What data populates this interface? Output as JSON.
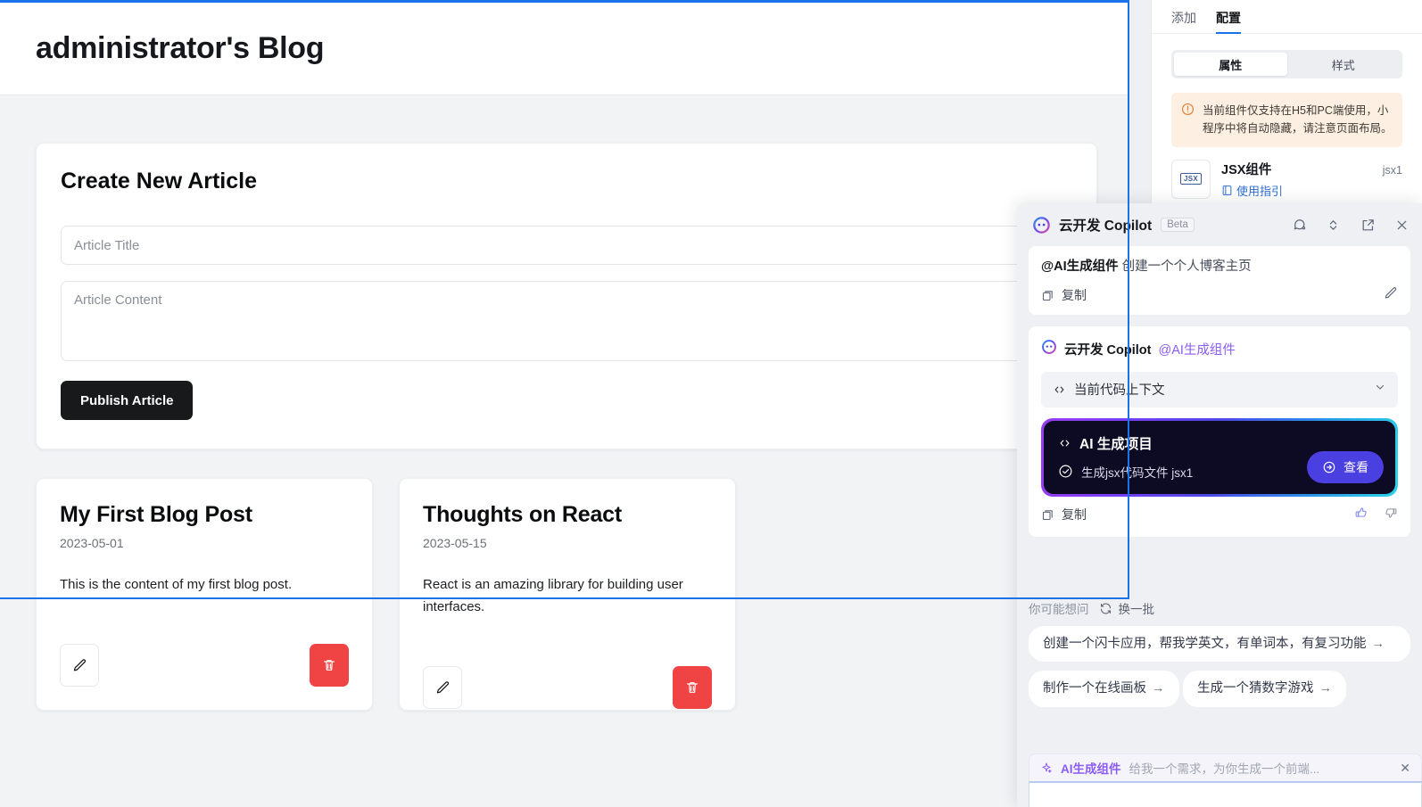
{
  "canvas": {
    "header_title": "administrator's Blog",
    "create": {
      "heading": "Create New Article",
      "title_placeholder": "Article Title",
      "title_value": "",
      "content_placeholder": "Article Content",
      "content_value": "",
      "publish_label": "Publish Article"
    },
    "posts": [
      {
        "title": "My First Blog Post",
        "date": "2023-05-01",
        "body": "This is the content of my first blog post.",
        "edit_icon": "pencil-icon",
        "delete_icon": "trash-icon"
      },
      {
        "title": "Thoughts on React",
        "date": "2023-05-15",
        "body": "React is an amazing library for building user interfaces.",
        "edit_icon": "pencil-icon",
        "delete_icon": "trash-icon"
      }
    ]
  },
  "rightbar": {
    "tabs": [
      {
        "label": "添加",
        "active": false
      },
      {
        "label": "配置",
        "active": true
      }
    ],
    "segments": [
      {
        "label": "属性",
        "active": true
      },
      {
        "label": "样式",
        "active": false
      }
    ],
    "warning": {
      "icon": "warning-circle-icon",
      "text": "当前组件仅支持在H5和PC端使用，小程序中将自动隐藏，请注意页面布局。"
    },
    "component": {
      "badge": "JSX",
      "name": "JSX组件",
      "id": "jsx1",
      "link_label": "使用指引",
      "link_icon": "book-icon"
    }
  },
  "copilot": {
    "logo_icon": "copilot-logo-icon",
    "title": "云开发 Copilot",
    "beta": "Beta",
    "actions": [
      {
        "icon": "chat-history-icon"
      },
      {
        "icon": "expand-collapse-icon"
      },
      {
        "icon": "open-external-icon"
      },
      {
        "icon": "close-icon"
      }
    ],
    "user_message": {
      "mention": "@AI生成组件",
      "text": "创建一个个人博客主页",
      "copy_label": "复制",
      "copy_icon": "copy-icon",
      "edit_icon": "pencil-icon"
    },
    "ai_message": {
      "name": "云开发 Copilot",
      "mention": "@AI生成组件",
      "context_bar": {
        "icon": "code-tag-icon",
        "label": "当前代码上下文",
        "chevron": "chevron-down-icon"
      },
      "project_card": {
        "icon": "code-tag-icon",
        "title": "AI 生成项目",
        "status_icon": "check-circle-icon",
        "status_text": "生成jsx代码文件 jsx1",
        "view_label": "查看",
        "view_icon": "arrow-right-circle-icon",
        "gradient": [
          "#9a3df0",
          "#4f46e5",
          "#2ed3e8"
        ],
        "background": "#0d0b24"
      },
      "copy_label": "复制",
      "copy_icon": "copy-icon",
      "like_icon": "thumbs-up-icon",
      "dislike_icon": "thumbs-down-icon"
    },
    "suggestions": {
      "label": "你可能想问",
      "refresh_label": "换一批",
      "refresh_icon": "refresh-icon",
      "items": [
        "创建一个闪卡应用，帮我学英文，有单词本，有复习功能",
        "制作一个在线画板",
        "生成一个猜数字游戏"
      ],
      "arrow": "→"
    },
    "composer": {
      "tag_icon": "sparkle-icon",
      "tag_name": "AI生成组件",
      "hint": "给我一个需求，为你生成一个前端...",
      "close_icon": "close-icon",
      "input_value": ""
    }
  },
  "colors": {
    "accent_blue": "#1a73e8",
    "purple": "#8b5cf6",
    "danger": "#f04343",
    "dark_button": "#18191b"
  }
}
